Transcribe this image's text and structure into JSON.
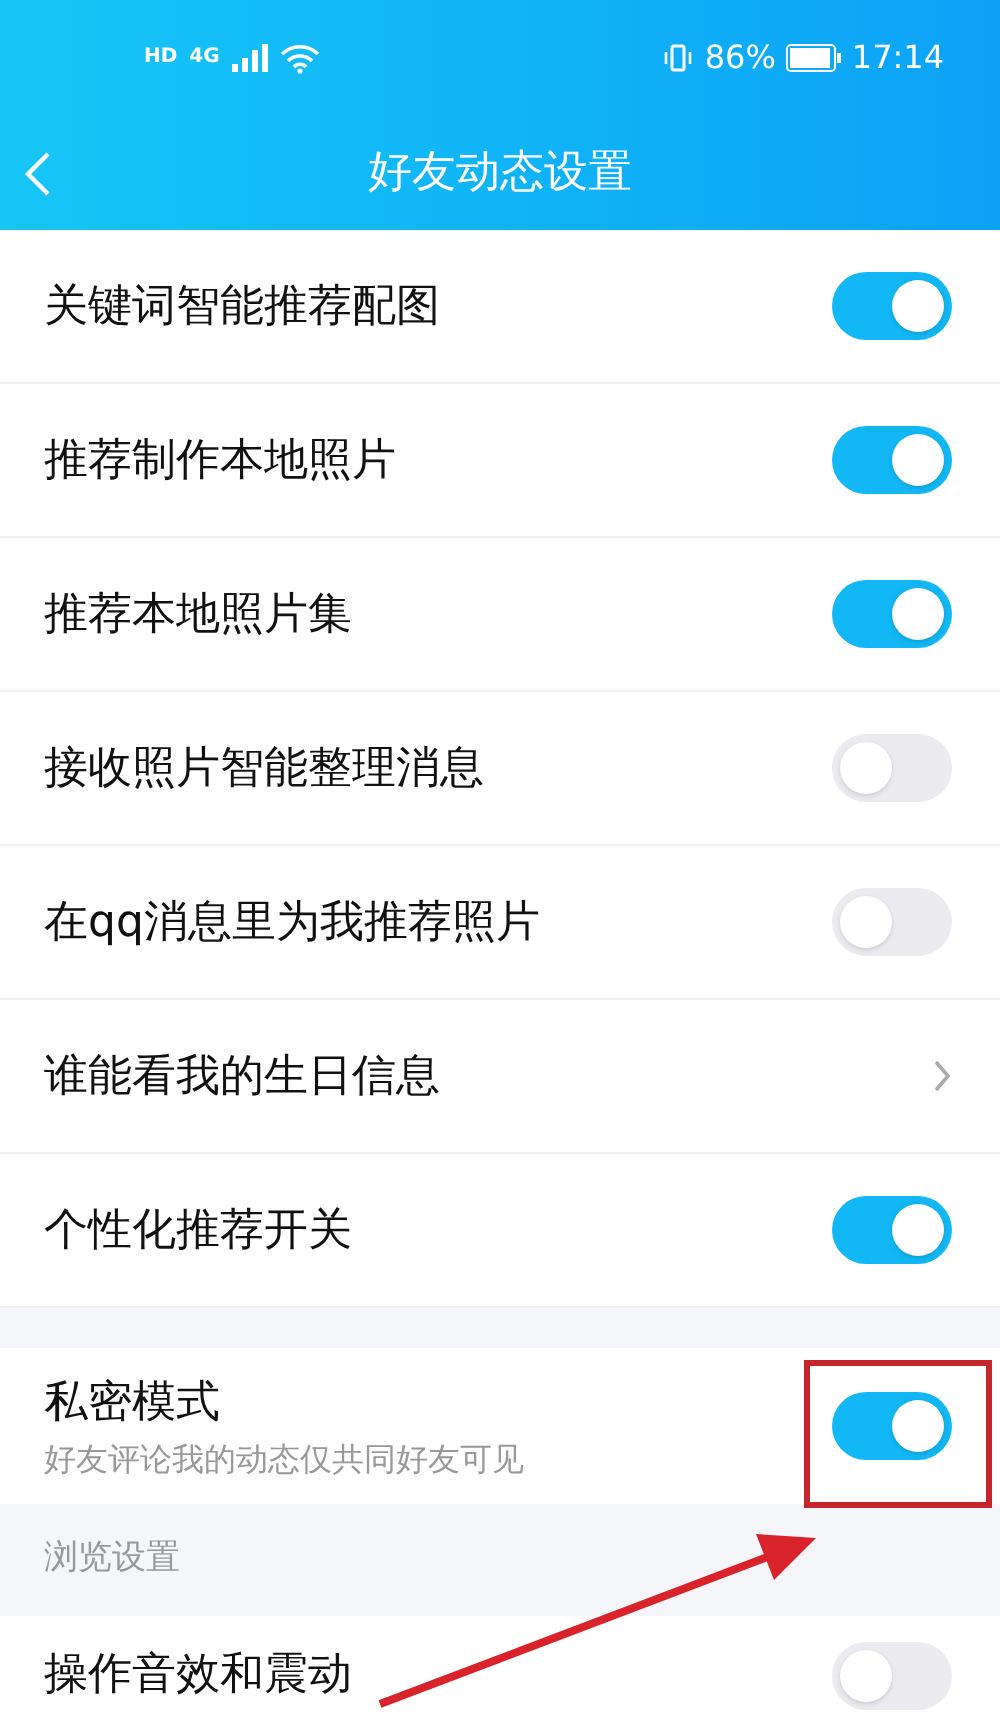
{
  "status_bar": {
    "network_badges": [
      "HD",
      "4G"
    ],
    "battery": "86%",
    "time": "17:14"
  },
  "header": {
    "title": "好友动态设置"
  },
  "items": [
    {
      "kind": "toggle",
      "label": "关键词智能推荐配图",
      "on": true
    },
    {
      "kind": "toggle",
      "label": "推荐制作本地照片",
      "on": true
    },
    {
      "kind": "toggle",
      "label": "推荐本地照片集",
      "on": true
    },
    {
      "kind": "toggle",
      "label": "接收照片智能整理消息",
      "on": false
    },
    {
      "kind": "toggle",
      "label": "在qq消息里为我推荐照片",
      "on": false
    },
    {
      "kind": "link",
      "label": "谁能看我的生日信息"
    },
    {
      "kind": "toggle",
      "label": "个性化推荐开关",
      "on": true
    }
  ],
  "privacy": {
    "label": "私密模式",
    "description": "好友评论我的动态仅共同好友可见",
    "on": true
  },
  "section": {
    "title": "浏览设置",
    "items": [
      {
        "kind": "toggle",
        "label": "操作音效和震动",
        "on": false
      }
    ]
  }
}
